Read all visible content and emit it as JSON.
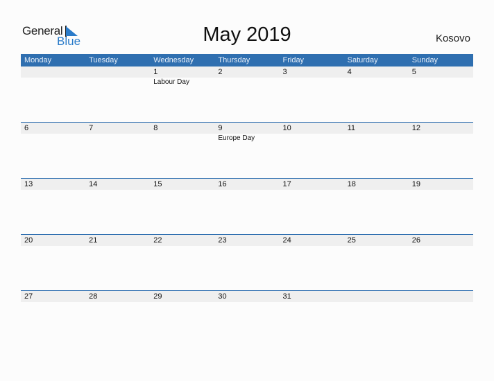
{
  "logo": {
    "word1": "General",
    "word2": "Blue"
  },
  "title": "May 2019",
  "country": "Kosovo",
  "weekdays": [
    "Monday",
    "Tuesday",
    "Wednesday",
    "Thursday",
    "Friday",
    "Saturday",
    "Sunday"
  ],
  "weeks": [
    {
      "days": [
        "",
        "",
        "1",
        "2",
        "3",
        "4",
        "5"
      ],
      "events": [
        "",
        "",
        "Labour Day",
        "",
        "",
        "",
        ""
      ]
    },
    {
      "days": [
        "6",
        "7",
        "8",
        "9",
        "10",
        "11",
        "12"
      ],
      "events": [
        "",
        "",
        "",
        "Europe Day",
        "",
        "",
        ""
      ]
    },
    {
      "days": [
        "13",
        "14",
        "15",
        "16",
        "17",
        "18",
        "19"
      ],
      "events": [
        "",
        "",
        "",
        "",
        "",
        "",
        ""
      ]
    },
    {
      "days": [
        "20",
        "21",
        "22",
        "23",
        "24",
        "25",
        "26"
      ],
      "events": [
        "",
        "",
        "",
        "",
        "",
        "",
        ""
      ]
    },
    {
      "days": [
        "27",
        "28",
        "29",
        "30",
        "31",
        "",
        ""
      ],
      "events": [
        "",
        "",
        "",
        "",
        "",
        "",
        ""
      ]
    }
  ],
  "colors": {
    "accent": "#2f6fb0",
    "logo_blue": "#2a7bc9",
    "row_bg": "#efefef"
  }
}
